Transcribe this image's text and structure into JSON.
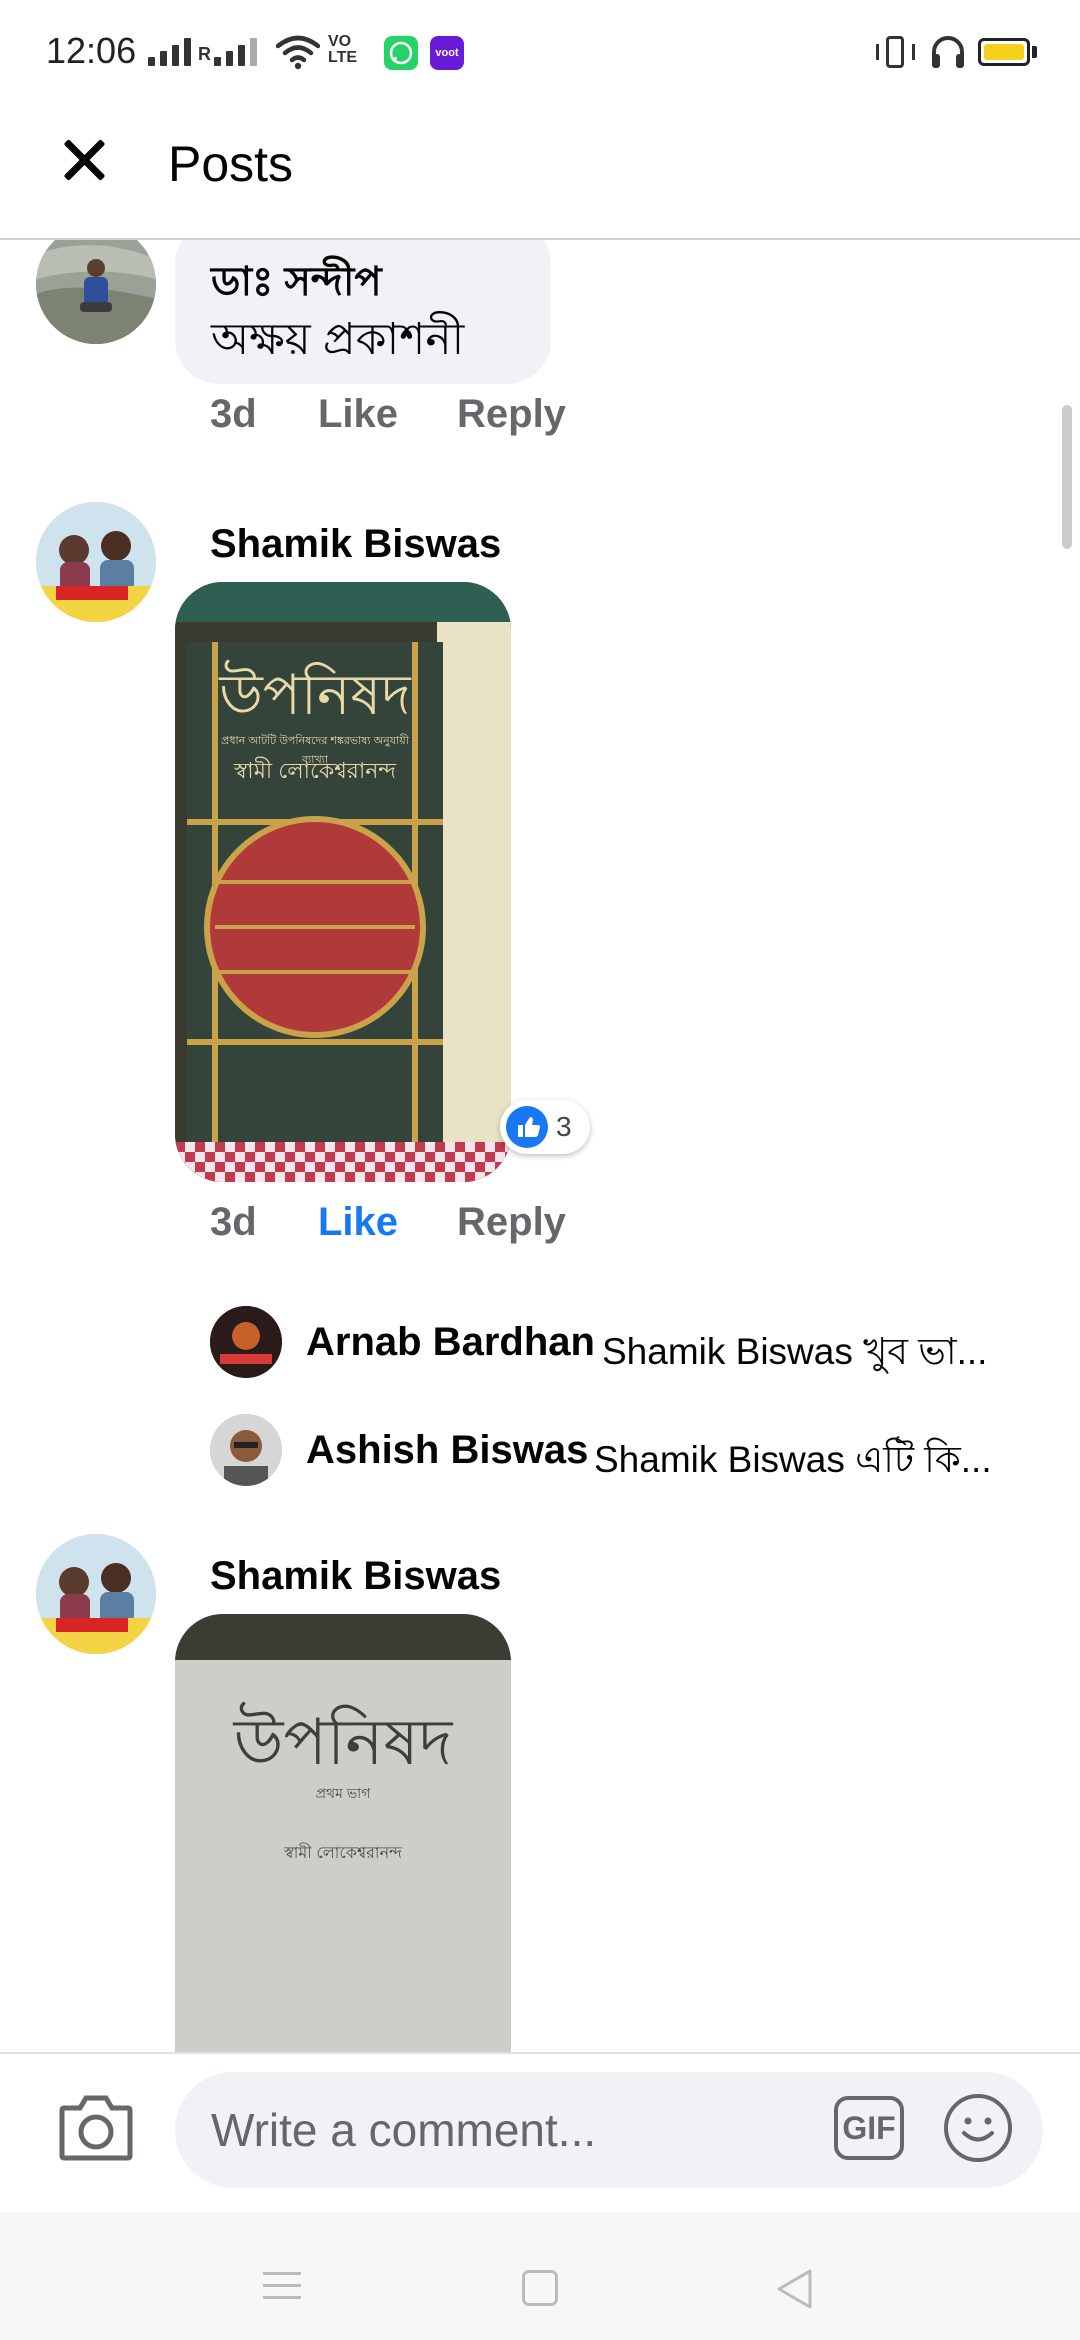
{
  "status_bar": {
    "time": "12:06",
    "network_label": "R",
    "volte_label": "VO LTE",
    "apps": [
      {
        "name": "whatsapp",
        "color": "#25d366",
        "label": ""
      },
      {
        "name": "voot",
        "color": "#6a1bd8",
        "label": "voot"
      }
    ],
    "battery_color": "#f4d21b"
  },
  "header": {
    "title": "Posts",
    "close_icon": "close-icon"
  },
  "comments": [
    {
      "author": "ডাঃ সন্দীপ",
      "text": "অক্ষয় প্রকাশনী",
      "time": "3d",
      "like_label": "Like",
      "reply_label": "Reply",
      "liked": false
    },
    {
      "author": "Shamik Biswas",
      "photo_book_title": "উপনিষদ",
      "photo_book_subtitle": "প্রধান আটটি উপনিষদের শঙ্করভাষ্য অনুযায়ী ব্যাখ্যা",
      "photo_book_author": "স্বামী লোকেশ্বরানন্দ",
      "reaction_count": "3",
      "time": "3d",
      "like_label": "Like",
      "reply_label": "Reply",
      "liked": true,
      "replies": [
        {
          "author": "Arnab Bardhan",
          "text": "Shamik Biswas খুব ভা..."
        },
        {
          "author": "Ashish Biswas",
          "text": "Shamik Biswas এটি কি..."
        }
      ]
    },
    {
      "author": "Shamik Biswas",
      "photo_book_title": "উপনিষদ",
      "photo_book_subtitle": "প্রথম ভাগ",
      "photo_book_author": "স্বামী লোকেশ্বরানন্দ"
    }
  ],
  "composer": {
    "placeholder": "Write a comment...",
    "gif_label": "GIF",
    "camera_icon": "camera-icon",
    "emoji_icon": "emoji-icon"
  },
  "colors": {
    "accent": "#1877f2",
    "meta_gray": "#65676b",
    "bubble": "#f0f2f5",
    "cover_green": "#34443a",
    "cover_red": "#b03a3a",
    "cover_gold": "#c9a24a"
  }
}
